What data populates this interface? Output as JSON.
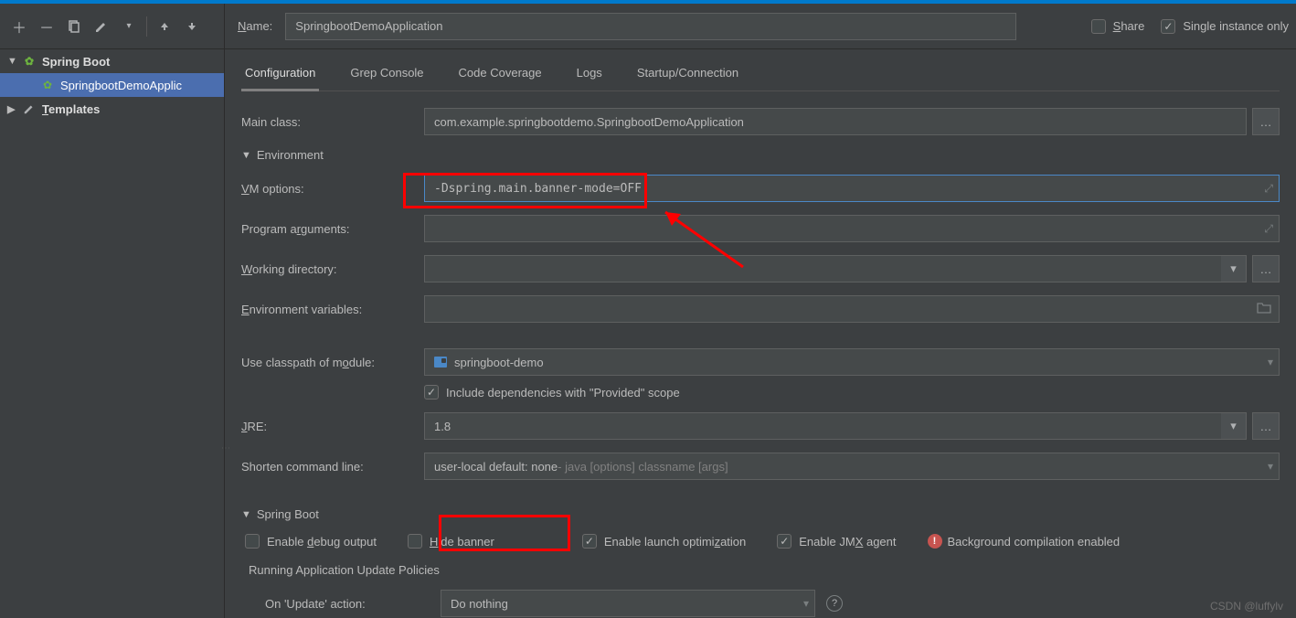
{
  "header": {
    "name_label_pre": "N",
    "name_label_post": "ame:",
    "name_value": "SpringbootDemoApplication",
    "share_label_pre": "S",
    "share_label_post": "hare",
    "single_instance_label": "Single instance only"
  },
  "sidebar": {
    "spring_boot": "Spring Boot",
    "app_item": "SpringbootDemoApplic",
    "templates_pre": "T",
    "templates_post": "emplates"
  },
  "tabs": {
    "configuration": "Configuration",
    "grep_console": "Grep Console",
    "code_coverage": "Code Coverage",
    "logs": "Logs",
    "startup": "Startup/Connection"
  },
  "form": {
    "main_class_label": "Main class:",
    "main_class_value": "com.example.springbootdemo.SpringbootDemoApplication",
    "environment_header": "Environment",
    "vm_label_pre": "V",
    "vm_label_mid": "M options:",
    "vm_value": "-Dspring.main.banner-mode=OFF",
    "prog_args_pre": "Program a",
    "prog_args_u": "r",
    "prog_args_post": "guments:",
    "workdir_pre": "W",
    "workdir_post": "orking directory:",
    "env_vars_pre": "E",
    "env_vars_post": "nvironment variables:",
    "classpath_pre": "Use classpath of m",
    "classpath_u": "o",
    "classpath_post": "dule:",
    "classpath_value": "springboot-demo",
    "include_provided": "Include dependencies with \"Provided\" scope",
    "jre_pre": "J",
    "jre_post": "RE:",
    "jre_value": "1.8",
    "shorten_label": "Shorten command line:",
    "shorten_value_1": "user-local default: none",
    "shorten_value_2": " - java [options] classname [args]",
    "spring_boot_header": "Spring Boot",
    "enable_debug_pre": "Enable ",
    "enable_debug_u": "d",
    "enable_debug_post": "ebug output",
    "hide_banner_pre": "H",
    "hide_banner_post": "ide banner",
    "enable_launch_pre": "Enable launch optimi",
    "enable_launch_u": "z",
    "enable_launch_post": "ation",
    "enable_jmx_pre": "Enable JM",
    "enable_jmx_u": "X",
    "enable_jmx_post": " agent",
    "bg_compile": "Background compilation enabled",
    "running_policies": "Running Application Update Policies",
    "on_update_label": "On 'Update' action:",
    "on_update_value": "Do nothing"
  },
  "watermark": "CSDN @luffylv"
}
